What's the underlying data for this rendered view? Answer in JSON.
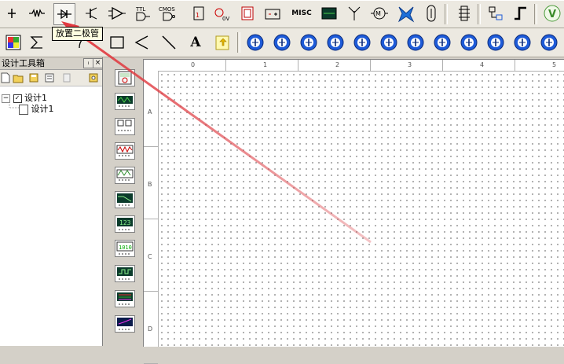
{
  "toolbar_components": {
    "icons": [
      "power-source-icon",
      "resistor-icon",
      "diode-icon",
      "transistor-icon",
      "analog-icon",
      "ttl-icon",
      "cmos-icon",
      "mcu-icon",
      "advanced-peripheral-icon",
      "digital-icon",
      "mixed-icon",
      "indicator-icon",
      "misc-label",
      "power-component-icon",
      "rf-icon",
      "electromechanical-icon",
      "place-ladder-icon",
      "connector-icon",
      "hierarchical-block-icon",
      "bus-icon",
      "multisim-v-icon"
    ],
    "ttl_label": "TTL",
    "cmos_label": "CMOS",
    "misc_label": "MISC",
    "tooltip": "放置二极管"
  },
  "toolbar_drawing": {
    "icons": [
      "color-fill-icon",
      "sigma-icon",
      "arc-icon",
      "rectangle-icon",
      "polyline-icon",
      "line-icon",
      "text-icon",
      "image-icon"
    ],
    "text_label": "A",
    "instrument_count": 12
  },
  "design_toolbox": {
    "title": "设计工具箱",
    "pin_label": "ᵢ",
    "close_label": "×",
    "tree": {
      "root": "设计1",
      "child": "设计1"
    }
  },
  "ruler": {
    "top": [
      "0",
      "1",
      "2",
      "3",
      "4",
      "5"
    ],
    "left": [
      "A",
      "B",
      "C",
      "D"
    ]
  },
  "colors": {
    "toolbar_bg": "#ece9e1",
    "instrument_blue": "#1e5bd8",
    "arrow_red": "#d9383f"
  }
}
